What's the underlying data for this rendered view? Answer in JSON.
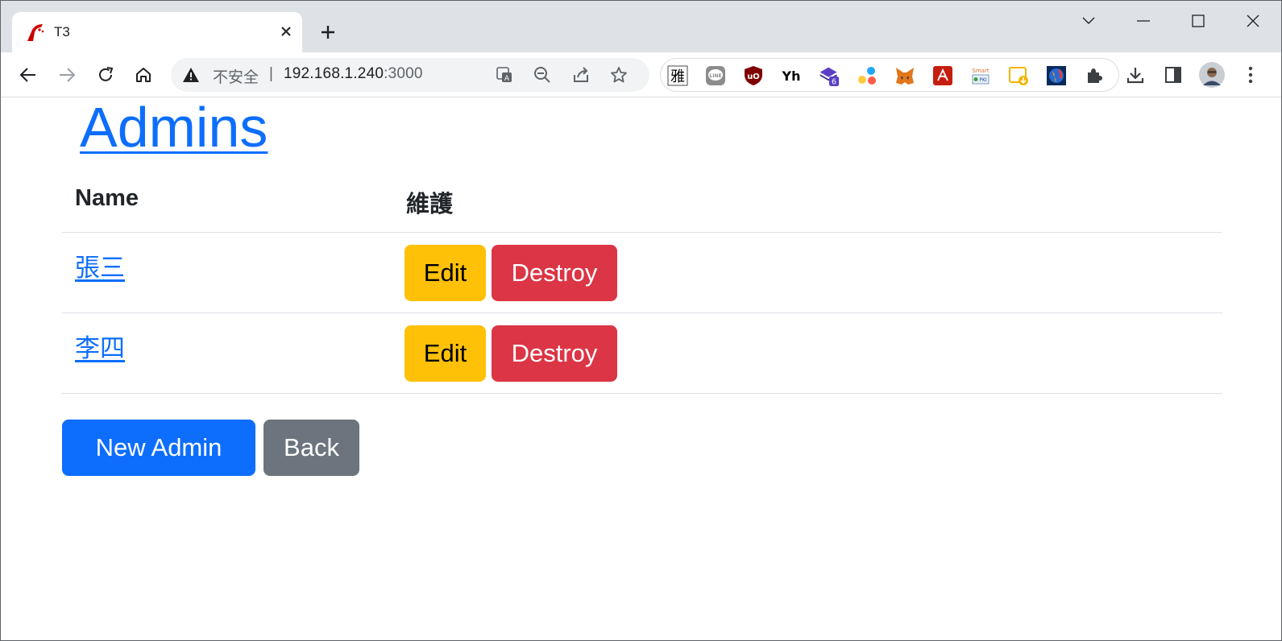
{
  "browser": {
    "tab": {
      "title": "T3",
      "favicon": "ruby-on-rails-icon"
    },
    "address": {
      "security_label": "不安全",
      "separator": "|",
      "host": "192.168.1.240",
      "port": ":3000"
    },
    "extensions": [
      {
        "name": "yahoo-dictionary-extension-icon",
        "text": "雅"
      },
      {
        "name": "line-extension-icon",
        "text": "LINE"
      },
      {
        "name": "ublock-origin-extension-icon",
        "text": "uO"
      },
      {
        "name": "yh-extension-icon",
        "text": "Yh"
      },
      {
        "name": "stack-extension-icon",
        "badge": "6"
      },
      {
        "name": "dots-extension-icon"
      },
      {
        "name": "metamask-extension-icon"
      },
      {
        "name": "acrobat-extension-icon"
      },
      {
        "name": "smart-pki-extension-icon",
        "text": "Smart PKI"
      },
      {
        "name": "calendar-download-extension-icon"
      },
      {
        "name": "globe-extension-icon"
      },
      {
        "name": "puzzle-extensions-icon"
      }
    ]
  },
  "page": {
    "title": "Admins",
    "table": {
      "headers": [
        "Name",
        "維護"
      ],
      "rows": [
        {
          "name": "張三",
          "edit_label": "Edit",
          "destroy_label": "Destroy"
        },
        {
          "name": "李四",
          "edit_label": "Edit",
          "destroy_label": "Destroy"
        }
      ]
    },
    "actions": {
      "new_label": "New Admin",
      "back_label": "Back"
    }
  },
  "colors": {
    "primary": "#0d6efd",
    "warning": "#ffc107",
    "danger": "#dc3545",
    "secondary": "#6c757d"
  }
}
